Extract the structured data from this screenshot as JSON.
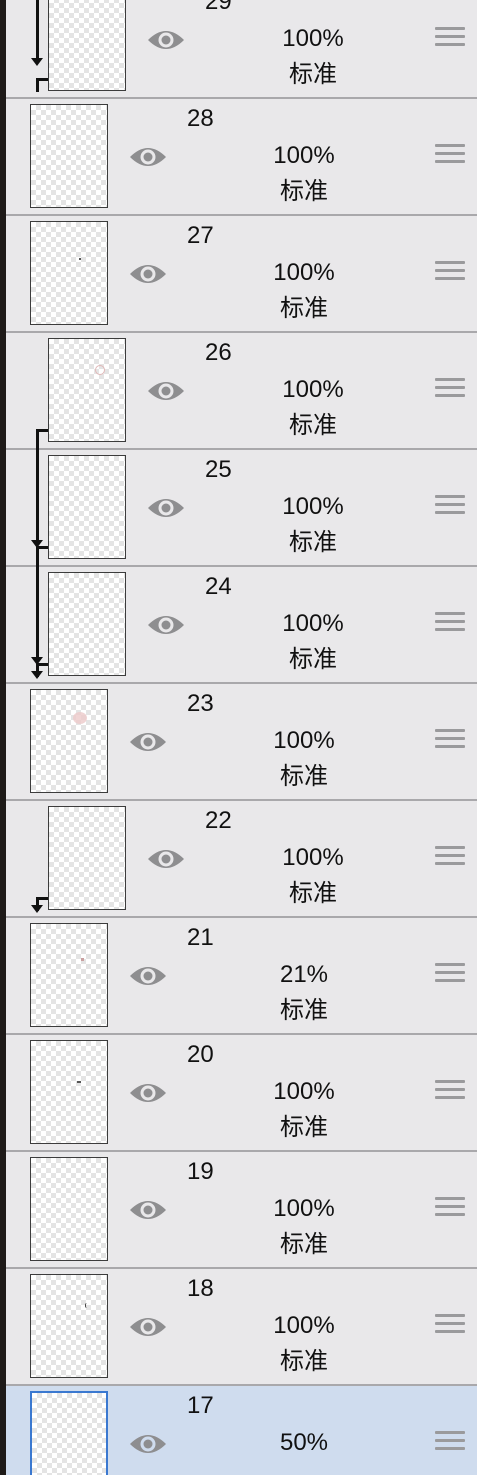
{
  "layers_panel": {
    "layers": [
      {
        "name": "29",
        "opacity": "100%",
        "blend": "标准",
        "clipped": true,
        "selected": false
      },
      {
        "name": "28",
        "opacity": "100%",
        "blend": "标准",
        "clipped": false,
        "selected": false
      },
      {
        "name": "27",
        "opacity": "100%",
        "blend": "标准",
        "clipped": false,
        "selected": false
      },
      {
        "name": "26",
        "opacity": "100%",
        "blend": "标准",
        "clipped": true,
        "selected": false
      },
      {
        "name": "25",
        "opacity": "100%",
        "blend": "标准",
        "clipped": true,
        "selected": false
      },
      {
        "name": "24",
        "opacity": "100%",
        "blend": "标准",
        "clipped": true,
        "selected": false
      },
      {
        "name": "23",
        "opacity": "100%",
        "blend": "标准",
        "clipped": false,
        "selected": false
      },
      {
        "name": "22",
        "opacity": "100%",
        "blend": "标准",
        "clipped": true,
        "selected": false
      },
      {
        "name": "21",
        "opacity": "21%",
        "blend": "标准",
        "clipped": false,
        "selected": false
      },
      {
        "name": "20",
        "opacity": "100%",
        "blend": "标准",
        "clipped": false,
        "selected": false
      },
      {
        "name": "19",
        "opacity": "100%",
        "blend": "标准",
        "clipped": false,
        "selected": false
      },
      {
        "name": "18",
        "opacity": "100%",
        "blend": "标准",
        "clipped": false,
        "selected": false
      },
      {
        "name": "17",
        "opacity": "50%",
        "blend": "",
        "clipped": false,
        "selected": true
      }
    ],
    "icons": {
      "visibility": "eye-icon",
      "reorder": "drag-handle-icon",
      "clipping": "clipping-arrow-icon"
    },
    "colors": {
      "panel_bg": "#e9e8ea",
      "selected_bg": "#cfdcee",
      "selected_border": "#3a78d0",
      "eye_gray": "#8e8e90"
    }
  }
}
